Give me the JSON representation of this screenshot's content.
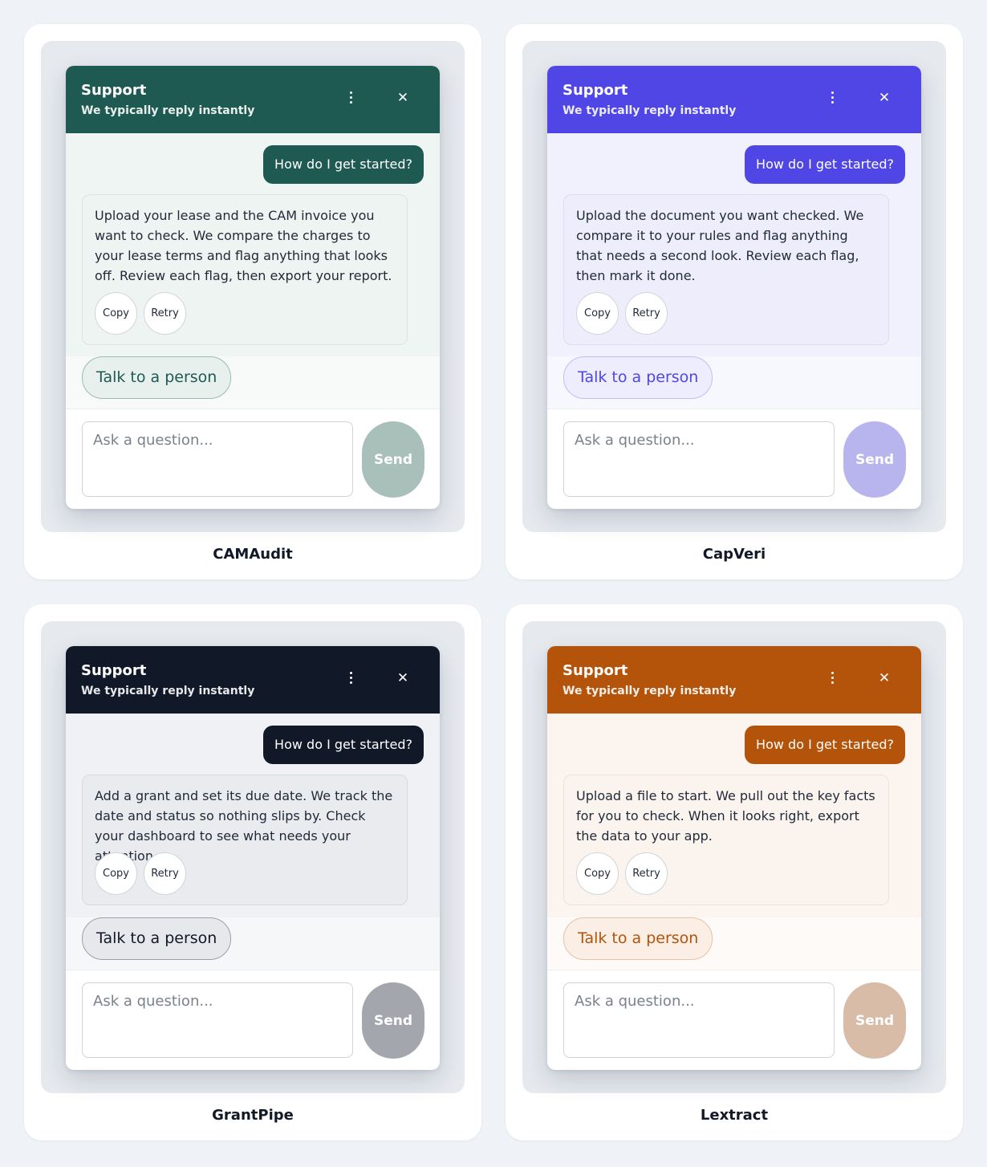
{
  "widgets": [
    {
      "name": "CAMAudit",
      "header_title": "Support",
      "header_subtitle": "We typically reply instantly",
      "user_message": "How do I get started?",
      "bot_message": "Upload your lease and the CAM invoice you want to check. We compare the charges to your lease terms and flag anything that looks off. Review each flag, then export your report.",
      "copy_label": "Copy",
      "retry_label": "Retry",
      "talk_label": "Talk to a person",
      "input_placeholder": "Ask a question...",
      "send_label": "Send",
      "colors": {
        "accent": "#1e5a52",
        "messages_bg": "#eff5f3",
        "bubble_bg": "#eef4f2",
        "bubble_border": "#d9e4e1",
        "handoff_bg": "#f7faf9",
        "talk_bg": "#e8f0ee",
        "talk_border": "#9bbab2",
        "talk_text": "#1e5a52",
        "send_bg": "#a9bfba"
      }
    },
    {
      "name": "CapVeri",
      "header_title": "Support",
      "header_subtitle": "We typically reply instantly",
      "user_message": "How do I get started?",
      "bot_message": "Upload the document you want checked. We compare it to your rules and flag anything that needs a second look. Review each flag, then mark it done.",
      "copy_label": "Copy",
      "retry_label": "Retry",
      "talk_label": "Talk to a person",
      "input_placeholder": "Ask a question...",
      "send_label": "Send",
      "colors": {
        "accent": "#4f46e5",
        "messages_bg": "#f1f1fd",
        "bubble_bg": "#ededfc",
        "bubble_border": "#dcdcf3",
        "handoff_bg": "#f7f7fe",
        "talk_bg": "#eeedfd",
        "talk_border": "#c0bdf2",
        "talk_text": "#4f46e5",
        "send_bg": "#b8b4ee"
      }
    },
    {
      "name": "GrantPipe",
      "header_title": "Support",
      "header_subtitle": "We typically reply instantly",
      "user_message": "How do I get started?",
      "bot_message": "Add a grant and set its due date. We track the date and status so nothing slips by. Check your dashboard to see what needs your attention.",
      "copy_label": "Copy",
      "retry_label": "Retry",
      "talk_label": "Talk to a person",
      "input_placeholder": "Ask a question...",
      "send_label": "Send",
      "colors": {
        "accent": "#111827",
        "messages_bg": "#eff1f5",
        "bubble_bg": "#e9ebef",
        "bubble_border": "#d5d8de",
        "handoff_bg": "#f6f7f9",
        "talk_bg": "#e6e8eb",
        "talk_border": "#9ca0a8",
        "talk_text": "#111827",
        "send_bg": "#a3a6ad"
      }
    },
    {
      "name": "Lextract",
      "header_title": "Support",
      "header_subtitle": "We typically reply instantly",
      "user_message": "How do I get started?",
      "bot_message": "Upload a file to start. We pull out the key facts for you to check. When it looks right, export the data to your app.",
      "copy_label": "Copy",
      "retry_label": "Retry",
      "talk_label": "Talk to a person",
      "input_placeholder": "Ask a question...",
      "send_label": "Send",
      "colors": {
        "accent": "#b4530a",
        "messages_bg": "#fcf4ef",
        "bubble_bg": "#fbf3ee",
        "bubble_border": "#ede1d8",
        "handoff_bg": "#fdfaf7",
        "talk_bg": "#fbeee5",
        "talk_border": "#e5c2a8",
        "talk_text": "#b4530a",
        "send_bg": "#d8bca8"
      }
    }
  ]
}
